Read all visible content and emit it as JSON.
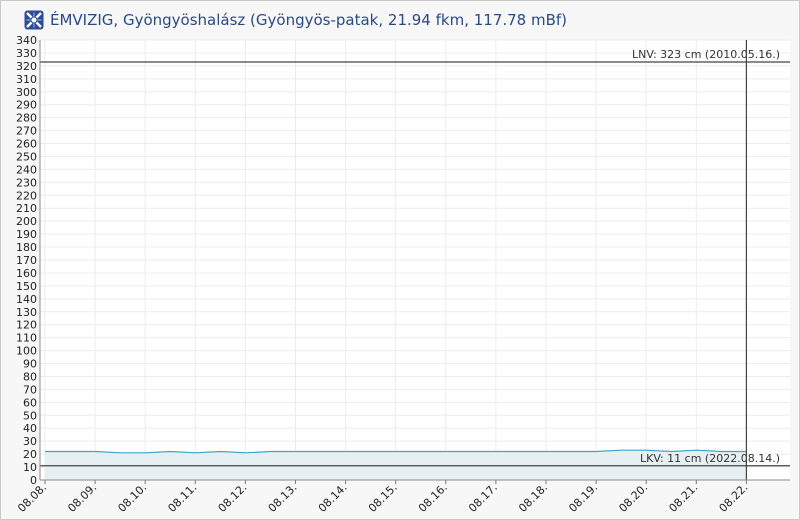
{
  "header": {
    "title": "ÉMVIZIG, Gyöngyöshalász (Gyöngyös-patak, 21.94 fkm, 117.78 mBf)",
    "logo_icon": "emvizig-logo-icon"
  },
  "chart_data": {
    "type": "area",
    "title": "ÉMVIZIG, Gyöngyöshalász (Gyöngyös-patak, 21.94 fkm, 117.78 mBf)",
    "xlabel": "",
    "ylabel": "",
    "ylim": [
      0,
      340
    ],
    "y_ticks": [
      0,
      10,
      20,
      30,
      40,
      50,
      60,
      70,
      80,
      90,
      100,
      110,
      120,
      130,
      140,
      150,
      160,
      170,
      180,
      190,
      200,
      210,
      220,
      230,
      240,
      250,
      260,
      270,
      280,
      290,
      300,
      310,
      320,
      330,
      340
    ],
    "x_ticks": [
      "08.08.",
      "08.09.",
      "08.10.",
      "08.11.",
      "08.12.",
      "08.13.",
      "08.14.",
      "08.15.",
      "08.16.",
      "08.17.",
      "08.18.",
      "08.19.",
      "08.20.",
      "08.21.",
      "08.22."
    ],
    "grid": true,
    "series": [
      {
        "color": "#3aa6c9",
        "fill": "#e6f0f3",
        "x": [
          "08.08.",
          "08.08.",
          "08.09.",
          "08.09.",
          "08.10.",
          "08.10.",
          "08.11.",
          "08.11.",
          "08.12.",
          "08.12.",
          "08.13.",
          "08.14.",
          "08.15.",
          "08.16.",
          "08.17.",
          "08.18.",
          "08.19.",
          "08.19.",
          "08.20.",
          "08.20.",
          "08.21.",
          "08.21.",
          "08.22."
        ],
        "values": [
          22,
          22,
          22,
          21,
          21,
          22,
          21,
          22,
          21,
          22,
          22,
          22,
          22,
          22,
          22,
          22,
          22,
          23,
          23,
          22,
          23,
          22,
          22
        ]
      }
    ],
    "reference_lines": [
      {
        "name": "LNV",
        "label": "LNV: 323 cm (2010.05.16.)",
        "value": 323,
        "color": "#444444"
      },
      {
        "name": "LKV",
        "label": "LKV: 11 cm (2022.08.14.)",
        "value": 11,
        "color": "#444444"
      }
    ],
    "current_marker": {
      "x": "08.22.",
      "color": "#444444"
    }
  }
}
